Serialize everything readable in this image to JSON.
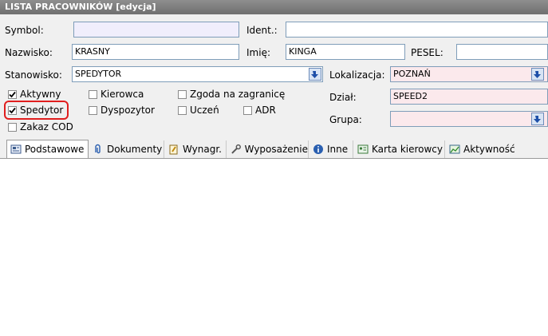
{
  "window": {
    "title": "LISTA PRACOWNIKÓW  [edycja]"
  },
  "form": {
    "symbol_label": "Symbol:",
    "symbol_value": "",
    "ident_label": "Ident.:",
    "ident_value": "",
    "nazwisko_label": "Nazwisko:",
    "nazwisko_value": "KRASNY",
    "imie_label": "Imię:",
    "imie_value": "KINGA",
    "pesel_label": "PESEL:",
    "pesel_value": "",
    "stanowisko_label": "Stanowisko:",
    "stanowisko_value": "SPEDYTOR",
    "lokalizacja_label": "Lokalizacja:",
    "lokalizacja_value": "POZNAŃ",
    "dzial_label": "Dział:",
    "dzial_value": "SPEED2",
    "grupa_label": "Grupa:",
    "grupa_value": ""
  },
  "checkboxes": [
    {
      "label": "Aktywny",
      "checked": true
    },
    {
      "label": "Spedytor",
      "checked": true
    },
    {
      "label": "Zakaz COD",
      "checked": false
    },
    {
      "label": "Kierowca",
      "checked": false
    },
    {
      "label": "Dyspozytor",
      "checked": false
    },
    {
      "label": "Zgoda na zagranicę",
      "checked": false
    },
    {
      "label": "Uczeń",
      "checked": false
    },
    {
      "label": "ADR",
      "checked": false
    }
  ],
  "tabs": [
    {
      "label": "Podstawowe",
      "icon": "form-icon",
      "active": true
    },
    {
      "label": "Dokumenty",
      "icon": "paperclip-icon",
      "active": false
    },
    {
      "label": "Wynagr.",
      "icon": "money-icon",
      "active": false
    },
    {
      "label": "Wyposażenie",
      "icon": "wrench-icon",
      "active": false
    },
    {
      "label": "Inne",
      "icon": "info-icon",
      "active": false
    },
    {
      "label": "Karta kierowcy",
      "icon": "id-card-icon",
      "active": false
    },
    {
      "label": "Aktywność",
      "icon": "chart-window-icon",
      "active": false
    }
  ],
  "colors": {
    "title_bar": "#7a7a7a",
    "highlight": "#e01e1e",
    "field_lavender": "#f0eefc",
    "field_pink": "#fbe9ec"
  }
}
